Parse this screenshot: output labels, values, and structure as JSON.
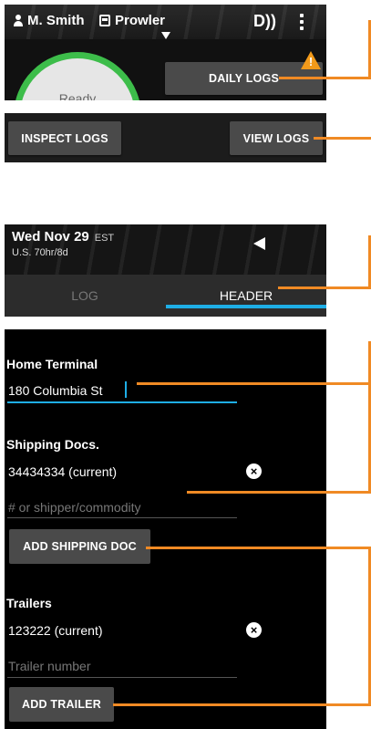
{
  "panel1": {
    "driver_name": "M. Smith",
    "vehicle_name": "Prowler",
    "brand_mark": "D))",
    "status": "Ready",
    "daily_logs_label": "DAILY LOGS",
    "warning_mark": "!"
  },
  "panel2": {
    "inspect_logs_label": "INSPECT LOGS",
    "view_logs_label": "VIEW LOGS"
  },
  "panel3": {
    "date": "Wed Nov 29",
    "timezone": "EST",
    "ruleset": "U.S. 70hr/8d",
    "tabs": [
      {
        "label": "LOG",
        "selected": false
      },
      {
        "label": "HEADER",
        "selected": true
      }
    ]
  },
  "panel4": {
    "home_terminal": {
      "label": "Home Terminal",
      "value": "180 Columbia St"
    },
    "shipping_docs": {
      "label": "Shipping Docs.",
      "current": "34434334 (current)",
      "placeholder": "# or shipper/commodity",
      "add_label": "ADD SHIPPING DOC"
    },
    "trailers": {
      "label": "Trailers",
      "current": "123222 (current)",
      "placeholder": "Trailer number",
      "add_label": "ADD TRAILER"
    },
    "remove_icon": "×"
  },
  "colors": {
    "accent_blue": "#1eaee6",
    "callout_orange": "#f08a24",
    "ready_green": "#3dbd4a",
    "warning_orange": "#f29a1a"
  }
}
